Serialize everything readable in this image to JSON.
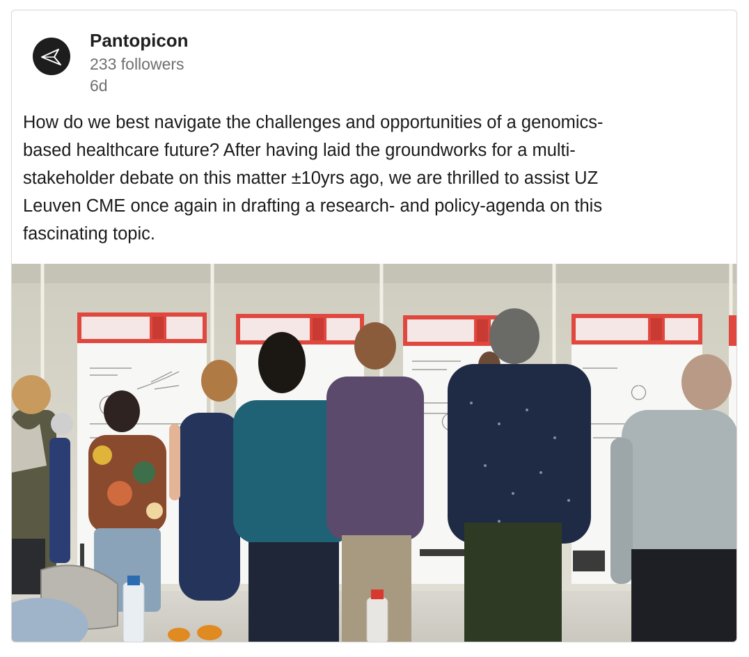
{
  "post": {
    "author": {
      "name": "Pantopicon",
      "followers": "233 followers",
      "time": "6d",
      "avatar_icon": "pantopicon-logo-icon"
    },
    "text_lines": [
      "How do we best navigate the challenges and opportunities of a genomics-",
      "based healthcare future? After having laid the groundworks for a multi-",
      "stakeholder debate on this matter ±10yrs ago, we are thrilled to assist UZ",
      "Leuven CME once again in drafting a research- and policy-agenda on this",
      "fascinating topic."
    ],
    "image": {
      "kind": "photo"
    }
  },
  "colors": {
    "text": "#1a1a1a",
    "muted": "#6f6f6f",
    "border": "#d9d9d9",
    "poster_red": "#e0483f",
    "wall": "#d8d6c9"
  }
}
